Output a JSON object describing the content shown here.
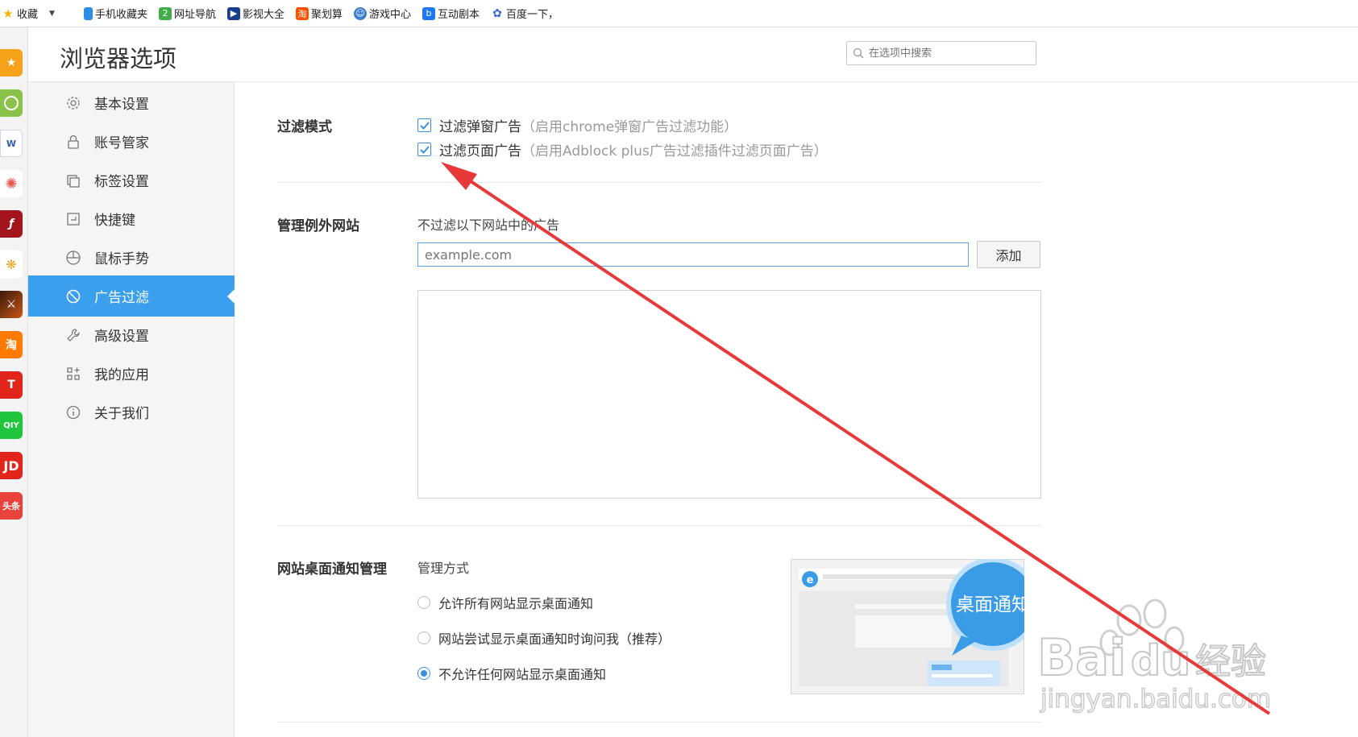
{
  "bookmarks": {
    "items": [
      {
        "label": "收藏",
        "icon": "star-icon",
        "color": "#f5b400"
      },
      {
        "label": "手机收藏夹",
        "icon": "phone-icon",
        "color": "#2d8ee8"
      },
      {
        "label": "网址导航",
        "icon": "nav-icon",
        "color": "#3fae49"
      },
      {
        "label": "影视大全",
        "icon": "film-icon",
        "color": "#1a3e8c"
      },
      {
        "label": "聚划算",
        "icon": "taobao-icon",
        "color": "#ff5000"
      },
      {
        "label": "游戏中心",
        "icon": "game-icon",
        "color": "#3a7fd5"
      },
      {
        "label": "互动剧本",
        "icon": "drama-icon",
        "color": "#1d77f2"
      },
      {
        "label": "百度一下，",
        "icon": "baidu-paw-icon",
        "color": "#2f63d8"
      }
    ]
  },
  "page": {
    "title": "浏览器选项",
    "search_placeholder": "在选项中搜索"
  },
  "nav": {
    "items": [
      {
        "label": "基本设置",
        "icon": "gear-icon"
      },
      {
        "label": "账号管家",
        "icon": "lock-icon"
      },
      {
        "label": "标签设置",
        "icon": "tabs-icon"
      },
      {
        "label": "快捷键",
        "icon": "shortcut-icon"
      },
      {
        "label": "鼠标手势",
        "icon": "mouse-icon"
      },
      {
        "label": "广告过滤",
        "icon": "block-icon",
        "active": true
      },
      {
        "label": "高级设置",
        "icon": "wrench-icon"
      },
      {
        "label": "我的应用",
        "icon": "apps-icon"
      },
      {
        "label": "关于我们",
        "icon": "info-icon"
      }
    ],
    "active_color": "#3b9ff0"
  },
  "filter_mode": {
    "label": "过滤模式",
    "options": [
      {
        "label": "过滤弹窗广告",
        "hint": "（启用chrome弹窗广告过滤功能）",
        "checked": true
      },
      {
        "label": "过滤页面广告",
        "hint": "（启用Adblock plus广告过滤插件过滤页面广告）",
        "checked": true
      }
    ]
  },
  "exceptions": {
    "label": "管理例外网站",
    "description": "不过滤以下网站中的广告",
    "input_placeholder": "example.com",
    "add_button": "添加"
  },
  "notifications": {
    "label": "网站桌面通知管理",
    "method_label": "管理方式",
    "options": [
      {
        "label": "允许所有网站显示桌面通知",
        "selected": false
      },
      {
        "label": "网站尝试显示桌面通知时询问我（推荐）",
        "selected": false
      },
      {
        "label": "不允许任何网站显示桌面通知",
        "selected": true
      }
    ],
    "preview_bubble": "桌面通知"
  },
  "watermark": {
    "brand": "Bai",
    "brand2": "du",
    "cn": "经验",
    "url": "jingyan.baidu.com"
  },
  "colors": {
    "accent": "#3b9ff0",
    "annotation_arrow": "#e8393a"
  }
}
